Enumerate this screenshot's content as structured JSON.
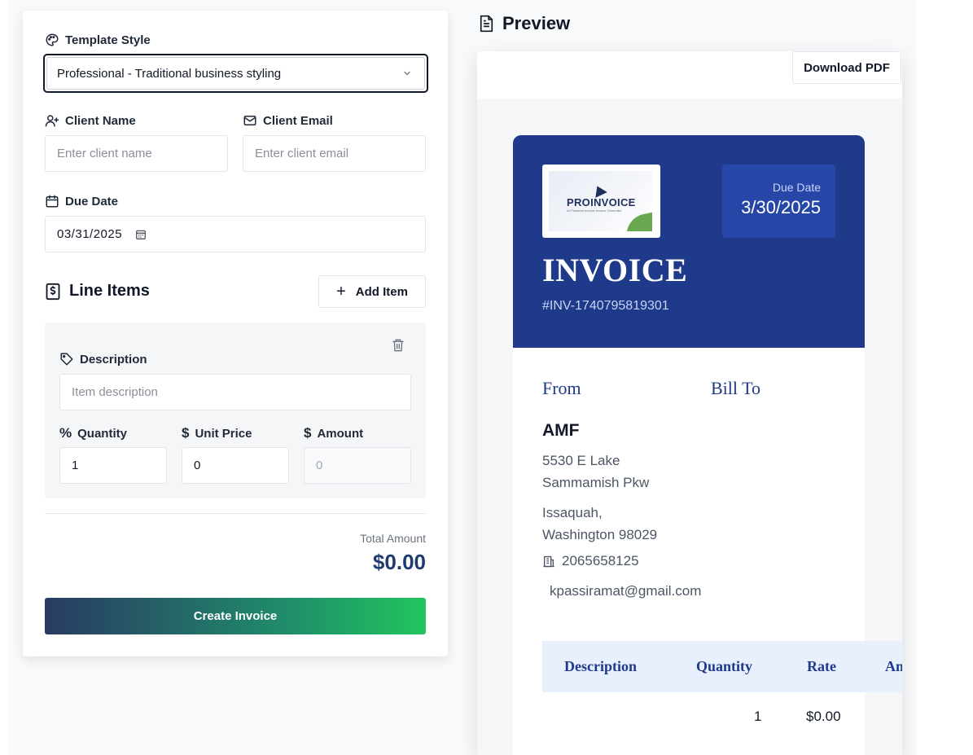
{
  "form": {
    "template_style": {
      "label": "Template Style",
      "selected": "Professional - Traditional business styling"
    },
    "client_name": {
      "label": "Client Name",
      "placeholder": "Enter client name"
    },
    "client_email": {
      "label": "Client Email",
      "placeholder": "Enter client email"
    },
    "due_date": {
      "label": "Due Date",
      "value": "03/31/2025"
    },
    "line_items": {
      "title": "Line Items",
      "add_label": "Add Item",
      "item": {
        "description_label": "Description",
        "description_placeholder": "Item description",
        "quantity_label": "Quantity",
        "quantity_value": "1",
        "unit_price_label": "Unit Price",
        "unit_price_value": "0",
        "amount_label": "Amount",
        "amount_value": "0"
      }
    },
    "total_label": "Total Amount",
    "total_value": "$0.00",
    "create_label": "Create Invoice"
  },
  "preview": {
    "title": "Preview",
    "download_label": "Download PDF",
    "invoice": {
      "logo_text": "PROINVOICE",
      "logo_tagline": "AI-Powered Invoice Invoice Generator",
      "due_label": "Due Date",
      "due_value": "3/30/2025",
      "title": "INVOICE",
      "number": "#INV-1740795819301",
      "from_label": "From",
      "bill_to_label": "Bill To",
      "from_name": "AMF",
      "address_line1": "5530 E Lake",
      "address_line2": "Sammamish Pkw",
      "address_line3": "Issaquah,",
      "address_line4": "Washington 98029",
      "phone": "2065658125",
      "email": "kpassiramat@gmail.com",
      "table": {
        "headers": [
          "Description",
          "Quantity",
          "Rate",
          "Amount"
        ],
        "rows": [
          {
            "description": "",
            "quantity": "1",
            "rate": "$0.00"
          }
        ]
      }
    }
  },
  "colors": {
    "primary": "#1f3a8a",
    "accent_green": "#22c55e",
    "total_text": "#1e3a6e"
  }
}
